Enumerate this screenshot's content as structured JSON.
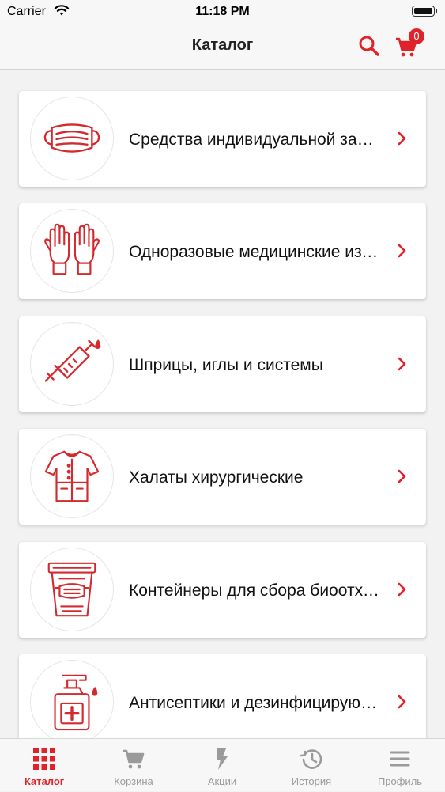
{
  "status_bar": {
    "carrier": "Carrier",
    "time": "11:18 PM"
  },
  "nav": {
    "title": "Каталог",
    "cart_count": "0",
    "accent": "#e0232b"
  },
  "categories": [
    {
      "label": "Средства индивидуальной защиты",
      "icon": "face-mask-icon"
    },
    {
      "label": "Одноразовые медицинские изделия",
      "icon": "gloves-icon"
    },
    {
      "label": "Шприцы, иглы и системы",
      "icon": "syringe-icon"
    },
    {
      "label": "Халаты хирургические",
      "icon": "surgical-gown-icon"
    },
    {
      "label": "Контейнеры для сбора биоотходов",
      "icon": "waste-container-icon"
    },
    {
      "label": "Антисептики и дезинфицирующие средства",
      "icon": "antiseptic-bottle-icon"
    }
  ],
  "tabs": [
    {
      "label": "Каталог",
      "icon": "grid-icon",
      "active": true
    },
    {
      "label": "Корзина",
      "icon": "cart-icon",
      "active": false
    },
    {
      "label": "Акции",
      "icon": "lightning-icon",
      "active": false
    },
    {
      "label": "История",
      "icon": "history-icon",
      "active": false
    },
    {
      "label": "Профиль",
      "icon": "menu-icon",
      "active": false
    }
  ]
}
